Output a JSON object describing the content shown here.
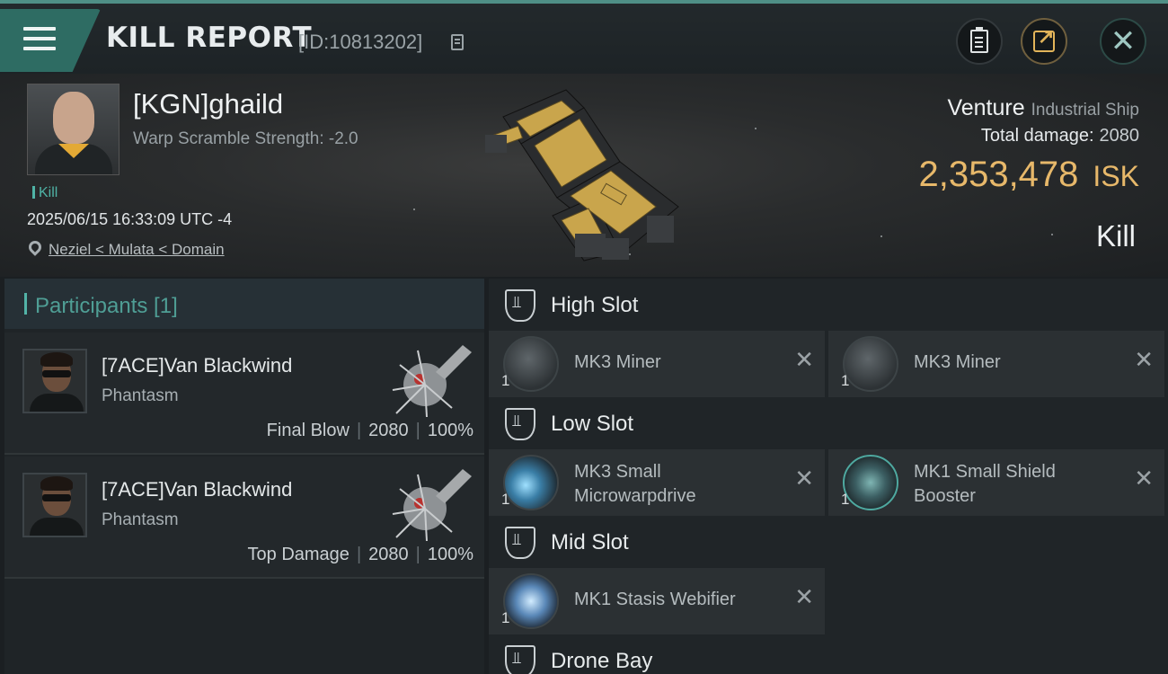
{
  "header": {
    "title": "KILL REPORT",
    "report_id": "[ID:10813202]"
  },
  "victim": {
    "name": "[KGN]ghaild",
    "warp_scramble": "Warp Scramble Strength: -2.0",
    "tag": "Kill",
    "datetime": "2025/06/15 16:33:09 UTC -4",
    "location": "Neziel < Mulata < Domain",
    "ship_name": "Venture",
    "ship_class": "Industrial Ship",
    "total_damage_label": "Total damage:",
    "total_damage": "2080",
    "isk_value": "2,353,478",
    "isk_unit": "ISK",
    "result": "Kill"
  },
  "participants": {
    "title": "Participants [1]",
    "rows": [
      {
        "name": "[7ACE]Van Blackwind",
        "ship": "Phantasm",
        "role": "Final Blow",
        "damage": "2080",
        "percent": "100%"
      },
      {
        "name": "[7ACE]Van Blackwind",
        "ship": "Phantasm",
        "role": "Top Damage",
        "damage": "2080",
        "percent": "100%"
      }
    ]
  },
  "fitting": {
    "high": {
      "title": "High Slot",
      "modules": [
        {
          "name": "MK3 Miner",
          "qty": "1",
          "icon": "miner-icon"
        },
        {
          "name": "MK3 Miner",
          "qty": "1",
          "icon": "miner-icon"
        }
      ]
    },
    "low": {
      "title": "Low Slot",
      "modules": [
        {
          "name": "MK3 Small Microwarpdrive",
          "qty": "1",
          "icon": "microwarpdrive-icon"
        },
        {
          "name": "MK1 Small Shield Booster",
          "qty": "1",
          "icon": "shield-booster-icon"
        }
      ]
    },
    "mid": {
      "title": "Mid Slot",
      "modules": [
        {
          "name": "MK1 Stasis Webifier",
          "qty": "1",
          "icon": "stasis-webifier-icon"
        }
      ]
    },
    "drone": {
      "title": "Drone Bay"
    }
  },
  "colors": {
    "accent": "#4fb3a6",
    "isk": "#e7b86a",
    "menu": "#2e6c63"
  }
}
